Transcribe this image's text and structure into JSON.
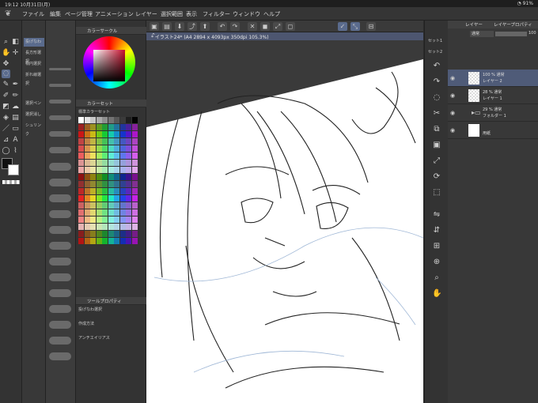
{
  "status": {
    "time": "19:12",
    "date": "10月31日(月)",
    "wifi": "wifi-icon",
    "battery": "91%"
  },
  "menu": [
    "ファイル",
    "編集",
    "ページ管理",
    "アニメーション",
    "レイヤー",
    "選択範囲",
    "表示",
    "フィルター",
    "ウィンドウ",
    "ヘルプ"
  ],
  "canvas_tab": {
    "title": "* イラスト24* (A4 2894 x 4093px 350dpi 105.3%)"
  },
  "subtools": {
    "items": [
      "投げなわ",
      "長方形選択",
      "楕円選択",
      "折れ線選択",
      "選択ペン",
      "選択消し",
      "シュリンク"
    ]
  },
  "color_panel": {
    "title": "カラーサークル",
    "set_title": "カラーセット",
    "set_name": "標準カラーセット"
  },
  "tool_property": {
    "title": "ツールプロパティ",
    "subtitle": "投げなわ選択",
    "row1": "作成方法",
    "row2": "アンチエイリアス"
  },
  "layers": {
    "tab_layer": "レイヤー",
    "tab_prop": "レイヤープロパティ",
    "blend": "通常",
    "opacity_value": "100",
    "set_label": "セット1",
    "set_label2": "セット2",
    "items": [
      {
        "opacity": "100 % 通常",
        "name": "レイヤー 2"
      },
      {
        "opacity": "28 % 通常",
        "name": "レイヤー 1"
      },
      {
        "opacity": "29 % 通常",
        "name": "フォルダー 1"
      },
      {
        "opacity": "",
        "name": "用紙"
      }
    ]
  }
}
